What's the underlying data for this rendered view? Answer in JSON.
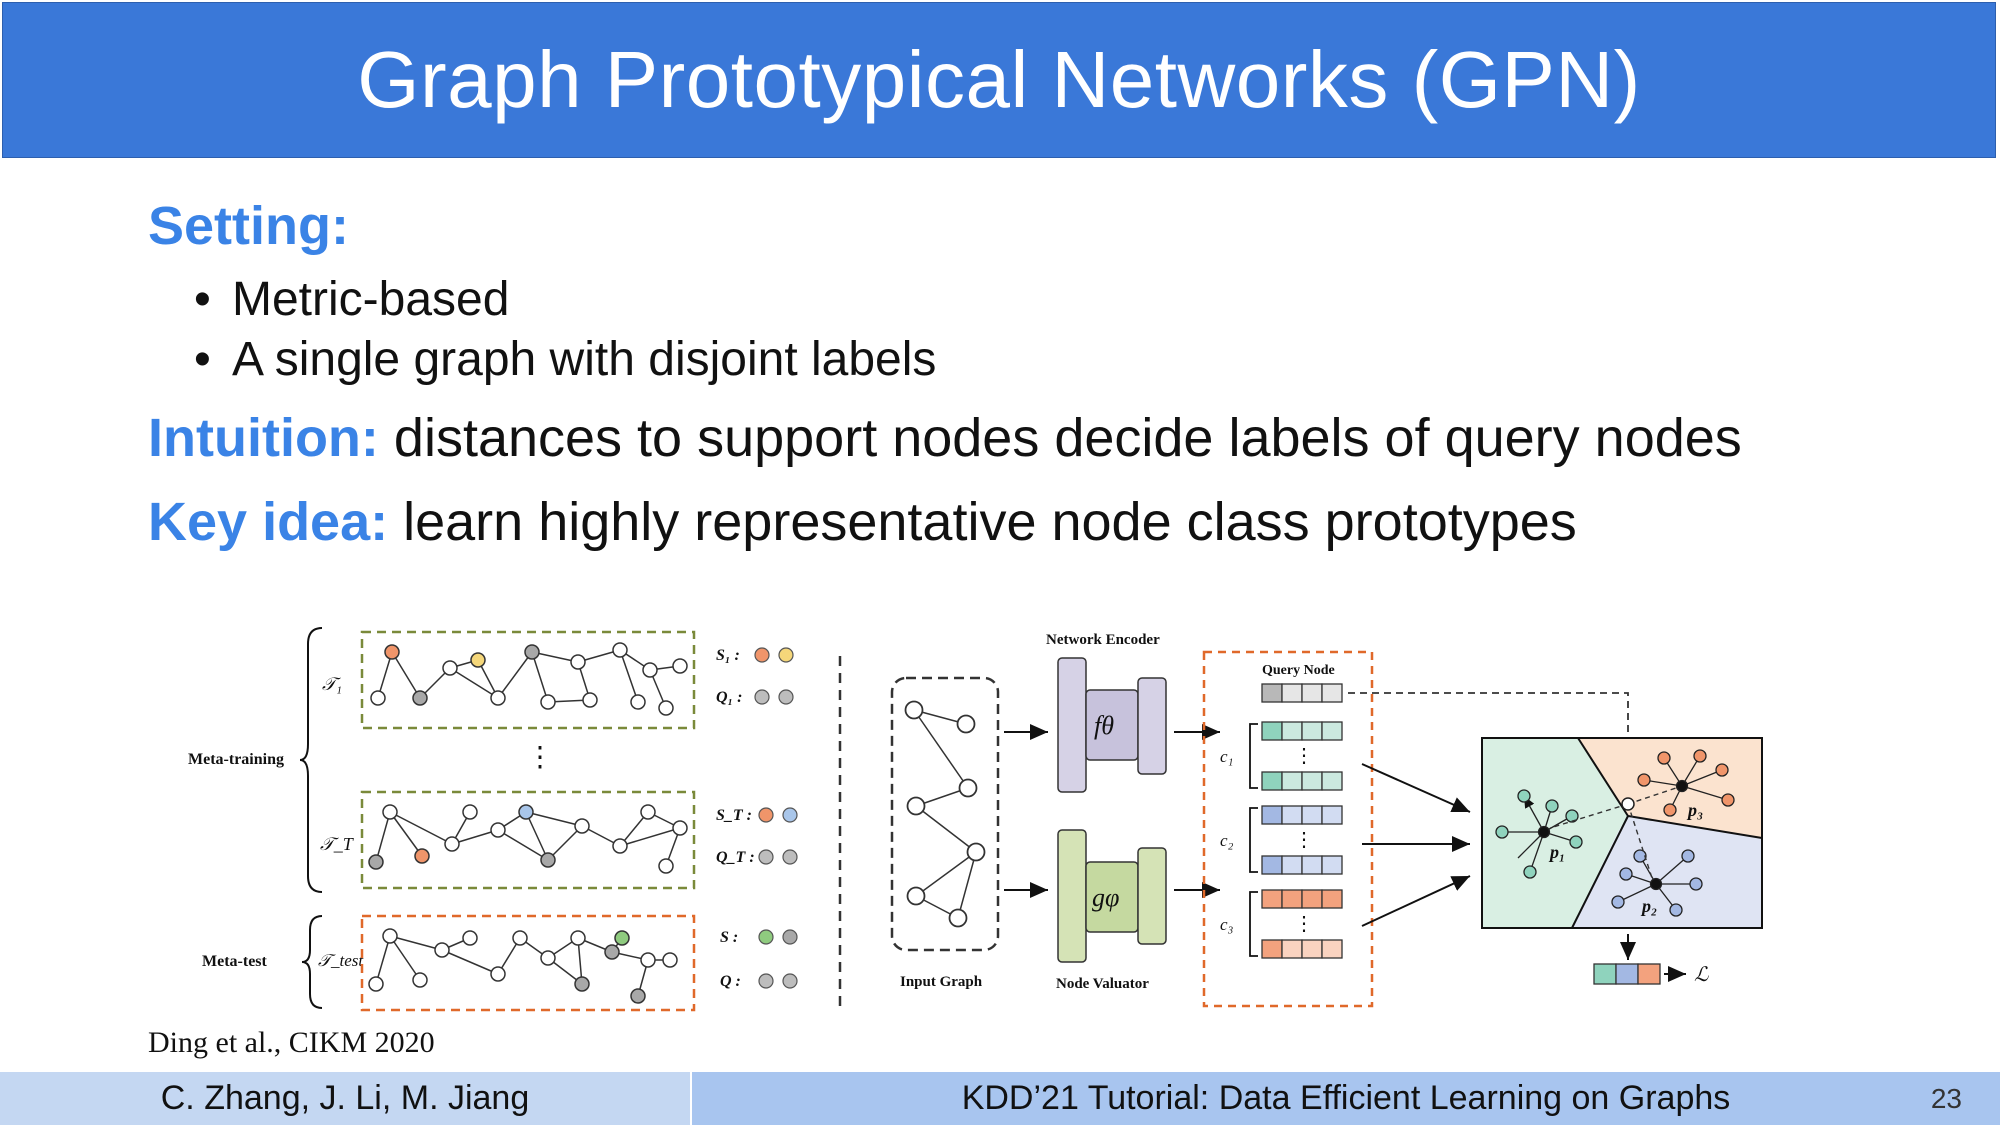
{
  "slide": {
    "title": "Graph Prototypical Networks (GPN)",
    "setting_heading": "Setting:",
    "bullets": [
      "Metric-based",
      "A single graph with disjoint labels"
    ],
    "intuition_label": "Intuition:",
    "intuition_text": " distances to support nodes decide labels of query nodes",
    "keyidea_label": "Key idea:",
    "keyidea_text": " learn highly representative node class prototypes",
    "citation": "Ding et al., CIKM 2020"
  },
  "figure": {
    "meta_training": "Meta-training",
    "meta_test": "Meta-test",
    "tau_1": "𝒯₁",
    "tau_T": "𝒯_T",
    "tau_test": "𝒯_test",
    "s1": "S₁ :",
    "q1": "Q₁ :",
    "sT": "S_T :",
    "qT": "Q_T :",
    "s": "S :",
    "q": "Q :",
    "network_encoder": "Network Encoder",
    "node_valuator": "Node Valuator",
    "input_graph": "Input Graph",
    "query_node": "Query Node",
    "f_theta": "fθ",
    "g_phi": "gφ",
    "c1": "c₁",
    "c2": "c₂",
    "c3": "c₃",
    "p1": "p₁",
    "p2": "p₂",
    "p3": "p₃",
    "loss": "ℒ",
    "colors": {
      "green_dash": "#7a8a3a",
      "orange_dash": "#e0692a",
      "orange_node": "#f0956a",
      "yellow_node": "#f5d77a",
      "blue_node": "#a9c6ea",
      "green_node": "#8fcb7f",
      "gray_node": "#a8a8a8",
      "teal_cell": "#8fd3bd",
      "blue_cell": "#a3b8e3",
      "orange_cell": "#f3a27e"
    }
  },
  "footer": {
    "authors": "C. Zhang, J. Li, M. Jiang",
    "tutorial": "KDD’21 Tutorial: Data Efficient Learning on Graphs",
    "page": "23"
  }
}
